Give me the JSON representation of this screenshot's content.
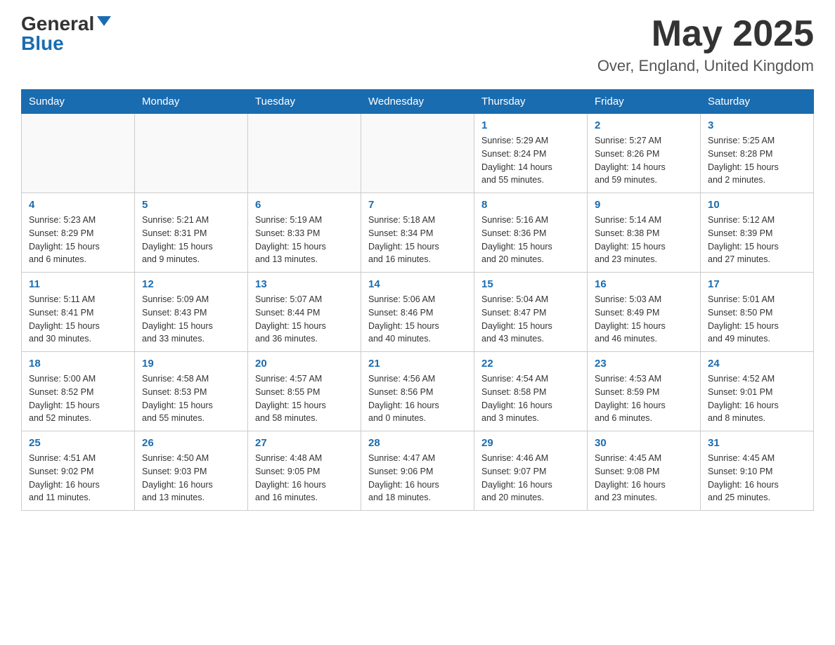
{
  "header": {
    "logo_general": "General",
    "logo_blue": "Blue",
    "month_title": "May 2025",
    "location": "Over, England, United Kingdom"
  },
  "weekdays": [
    "Sunday",
    "Monday",
    "Tuesday",
    "Wednesday",
    "Thursday",
    "Friday",
    "Saturday"
  ],
  "weeks": [
    [
      {
        "day": "",
        "info": ""
      },
      {
        "day": "",
        "info": ""
      },
      {
        "day": "",
        "info": ""
      },
      {
        "day": "",
        "info": ""
      },
      {
        "day": "1",
        "info": "Sunrise: 5:29 AM\nSunset: 8:24 PM\nDaylight: 14 hours\nand 55 minutes."
      },
      {
        "day": "2",
        "info": "Sunrise: 5:27 AM\nSunset: 8:26 PM\nDaylight: 14 hours\nand 59 minutes."
      },
      {
        "day": "3",
        "info": "Sunrise: 5:25 AM\nSunset: 8:28 PM\nDaylight: 15 hours\nand 2 minutes."
      }
    ],
    [
      {
        "day": "4",
        "info": "Sunrise: 5:23 AM\nSunset: 8:29 PM\nDaylight: 15 hours\nand 6 minutes."
      },
      {
        "day": "5",
        "info": "Sunrise: 5:21 AM\nSunset: 8:31 PM\nDaylight: 15 hours\nand 9 minutes."
      },
      {
        "day": "6",
        "info": "Sunrise: 5:19 AM\nSunset: 8:33 PM\nDaylight: 15 hours\nand 13 minutes."
      },
      {
        "day": "7",
        "info": "Sunrise: 5:18 AM\nSunset: 8:34 PM\nDaylight: 15 hours\nand 16 minutes."
      },
      {
        "day": "8",
        "info": "Sunrise: 5:16 AM\nSunset: 8:36 PM\nDaylight: 15 hours\nand 20 minutes."
      },
      {
        "day": "9",
        "info": "Sunrise: 5:14 AM\nSunset: 8:38 PM\nDaylight: 15 hours\nand 23 minutes."
      },
      {
        "day": "10",
        "info": "Sunrise: 5:12 AM\nSunset: 8:39 PM\nDaylight: 15 hours\nand 27 minutes."
      }
    ],
    [
      {
        "day": "11",
        "info": "Sunrise: 5:11 AM\nSunset: 8:41 PM\nDaylight: 15 hours\nand 30 minutes."
      },
      {
        "day": "12",
        "info": "Sunrise: 5:09 AM\nSunset: 8:43 PM\nDaylight: 15 hours\nand 33 minutes."
      },
      {
        "day": "13",
        "info": "Sunrise: 5:07 AM\nSunset: 8:44 PM\nDaylight: 15 hours\nand 36 minutes."
      },
      {
        "day": "14",
        "info": "Sunrise: 5:06 AM\nSunset: 8:46 PM\nDaylight: 15 hours\nand 40 minutes."
      },
      {
        "day": "15",
        "info": "Sunrise: 5:04 AM\nSunset: 8:47 PM\nDaylight: 15 hours\nand 43 minutes."
      },
      {
        "day": "16",
        "info": "Sunrise: 5:03 AM\nSunset: 8:49 PM\nDaylight: 15 hours\nand 46 minutes."
      },
      {
        "day": "17",
        "info": "Sunrise: 5:01 AM\nSunset: 8:50 PM\nDaylight: 15 hours\nand 49 minutes."
      }
    ],
    [
      {
        "day": "18",
        "info": "Sunrise: 5:00 AM\nSunset: 8:52 PM\nDaylight: 15 hours\nand 52 minutes."
      },
      {
        "day": "19",
        "info": "Sunrise: 4:58 AM\nSunset: 8:53 PM\nDaylight: 15 hours\nand 55 minutes."
      },
      {
        "day": "20",
        "info": "Sunrise: 4:57 AM\nSunset: 8:55 PM\nDaylight: 15 hours\nand 58 minutes."
      },
      {
        "day": "21",
        "info": "Sunrise: 4:56 AM\nSunset: 8:56 PM\nDaylight: 16 hours\nand 0 minutes."
      },
      {
        "day": "22",
        "info": "Sunrise: 4:54 AM\nSunset: 8:58 PM\nDaylight: 16 hours\nand 3 minutes."
      },
      {
        "day": "23",
        "info": "Sunrise: 4:53 AM\nSunset: 8:59 PM\nDaylight: 16 hours\nand 6 minutes."
      },
      {
        "day": "24",
        "info": "Sunrise: 4:52 AM\nSunset: 9:01 PM\nDaylight: 16 hours\nand 8 minutes."
      }
    ],
    [
      {
        "day": "25",
        "info": "Sunrise: 4:51 AM\nSunset: 9:02 PM\nDaylight: 16 hours\nand 11 minutes."
      },
      {
        "day": "26",
        "info": "Sunrise: 4:50 AM\nSunset: 9:03 PM\nDaylight: 16 hours\nand 13 minutes."
      },
      {
        "day": "27",
        "info": "Sunrise: 4:48 AM\nSunset: 9:05 PM\nDaylight: 16 hours\nand 16 minutes."
      },
      {
        "day": "28",
        "info": "Sunrise: 4:47 AM\nSunset: 9:06 PM\nDaylight: 16 hours\nand 18 minutes."
      },
      {
        "day": "29",
        "info": "Sunrise: 4:46 AM\nSunset: 9:07 PM\nDaylight: 16 hours\nand 20 minutes."
      },
      {
        "day": "30",
        "info": "Sunrise: 4:45 AM\nSunset: 9:08 PM\nDaylight: 16 hours\nand 23 minutes."
      },
      {
        "day": "31",
        "info": "Sunrise: 4:45 AM\nSunset: 9:10 PM\nDaylight: 16 hours\nand 25 minutes."
      }
    ]
  ]
}
